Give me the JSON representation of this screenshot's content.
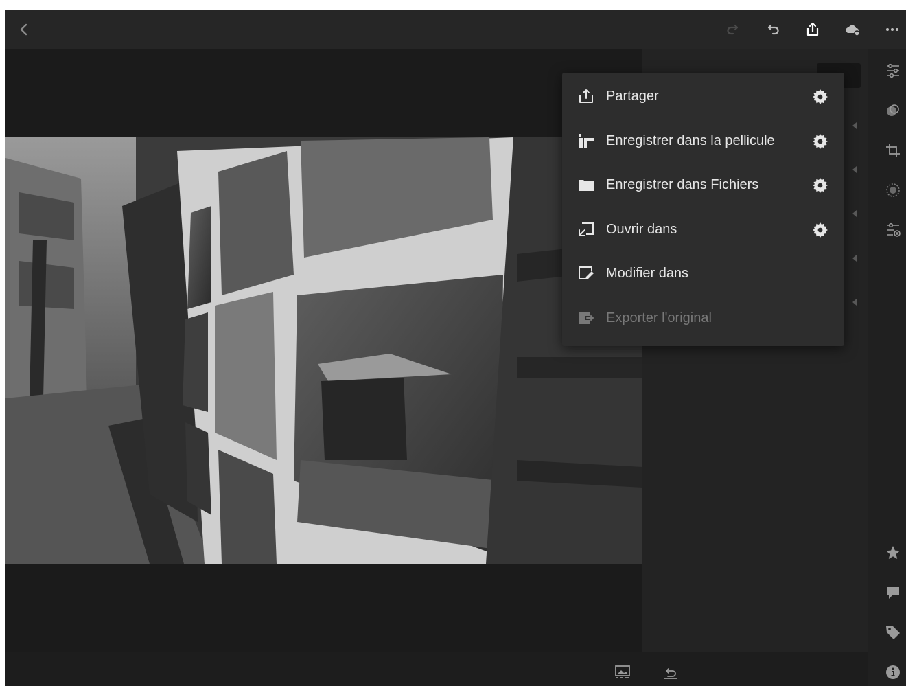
{
  "topbar": {
    "icons": {
      "back": "chevron-left-icon",
      "redo": "redo-icon",
      "undo": "undo-icon",
      "share": "share-icon",
      "cloud": "cloud-sync-icon",
      "more": "more-icon"
    }
  },
  "photo": {
    "description_icon": "photo"
  },
  "export_menu": {
    "items": [
      {
        "label": "Partager",
        "icon": "share-icon",
        "has_settings": true,
        "enabled": true
      },
      {
        "label": "Enregistrer dans la pellicule",
        "icon": "camera-roll-icon",
        "has_settings": true,
        "enabled": true
      },
      {
        "label": "Enregistrer dans Fichiers",
        "icon": "folder-icon",
        "has_settings": true,
        "enabled": true
      },
      {
        "label": "Ouvrir dans",
        "icon": "open-in-icon",
        "has_settings": true,
        "enabled": true
      },
      {
        "label": "Modifier dans",
        "icon": "edit-in-icon",
        "has_settings": false,
        "enabled": true
      },
      {
        "label": "Exporter l'original",
        "icon": "export-original-icon",
        "has_settings": false,
        "enabled": false
      }
    ]
  },
  "toolstrip": {
    "tools": [
      "sliders-icon",
      "presets-icon",
      "crop-icon",
      "healing-icon",
      "profile-icon",
      "star-icon",
      "comment-icon",
      "tag-icon",
      "info-icon"
    ]
  },
  "bottombar": {
    "icons": [
      "before-after-icon",
      "reset-icon"
    ]
  },
  "colors": {
    "background": "#1d1d1d",
    "menu": "#2d2d2d",
    "text": "#e6e6e6",
    "disabled_text": "#787878"
  }
}
